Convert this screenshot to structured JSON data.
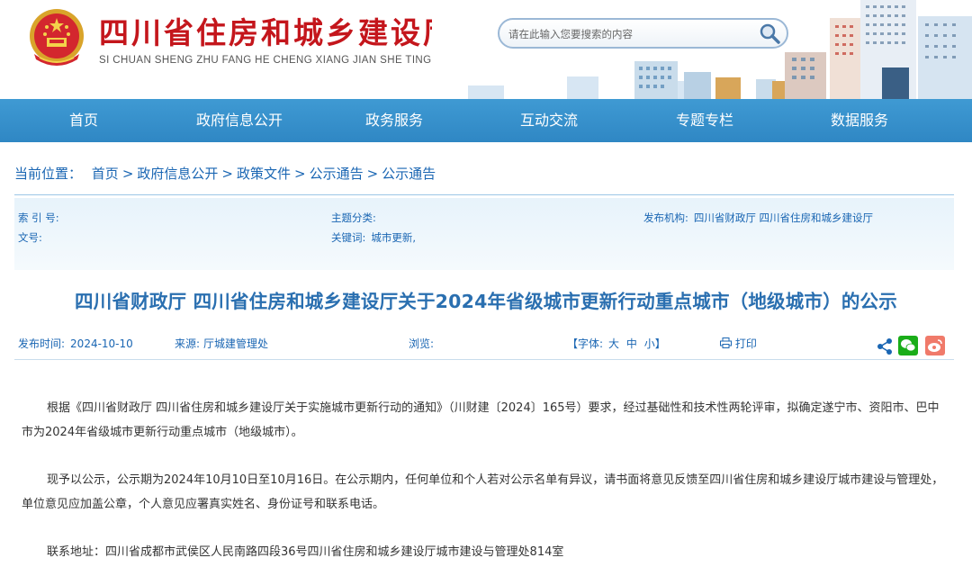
{
  "header": {
    "title": "四川省住房和城乡建设厅",
    "pinyin": "SI CHUAN SHENG ZHU FANG HE CHENG XIANG JIAN SHE TING",
    "search_placeholder": "请在此输入您要搜索的内容"
  },
  "nav": {
    "items": [
      {
        "label": "首页"
      },
      {
        "label": "政府信息公开"
      },
      {
        "label": "政务服务"
      },
      {
        "label": "互动交流"
      },
      {
        "label": "专题专栏"
      },
      {
        "label": "数据服务"
      }
    ]
  },
  "breadcrumb": {
    "prefix": "当前位置：",
    "items": [
      "首页",
      "政府信息公开",
      "政策文件",
      "公示通告",
      "公示通告"
    ],
    "separator": ">"
  },
  "meta": {
    "index_label": "索 引 号:",
    "doc_no_label": "文号:",
    "topic_label": "主题分类:",
    "keywords_label": "关键词:",
    "keywords_value": "城市更新,",
    "publisher_label": "发布机构:",
    "publisher_value": "四川省财政厅 四川省住房和城乡建设厅"
  },
  "article": {
    "title": "四川省财政厅 四川省住房和城乡建设厅关于2024年省级城市更新行动重点城市（地级城市）的公示",
    "publish_time_label": "发布时间:",
    "publish_time": "2024-10-10",
    "source_label": "来源:",
    "source": "厅城建管理处",
    "views_label": "浏览:",
    "font_label": "【字体:",
    "font_large": "大",
    "font_medium": "中",
    "font_small": "小",
    "font_close": "】",
    "print_label": "打印",
    "paragraphs": [
      "根据《四川省财政厅 四川省住房和城乡建设厅关于实施城市更新行动的通知》（川财建〔2024〕165号）要求，经过基础性和技术性两轮评审，拟确定遂宁市、资阳市、巴中市为2024年省级城市更新行动重点城市（地级城市）。",
      "现予以公示，公示期为2024年10月10日至10月16日。在公示期内，任何单位和个人若对公示名单有异议，请书面将意见反馈至四川省住房和城乡建设厅城市建设与管理处，单位意见应加盖公章，个人意见应署真实姓名、身份证号和联系电话。",
      "联系地址：四川省成都市武侯区人民南路四段36号四川省住房和城乡建设厅城市建设与管理处814室"
    ]
  },
  "colors": {
    "brand_red": "#c4161c",
    "nav_blue": "#2f87c4",
    "link_blue": "#1a66b3",
    "title_blue": "#2a6fb0"
  }
}
